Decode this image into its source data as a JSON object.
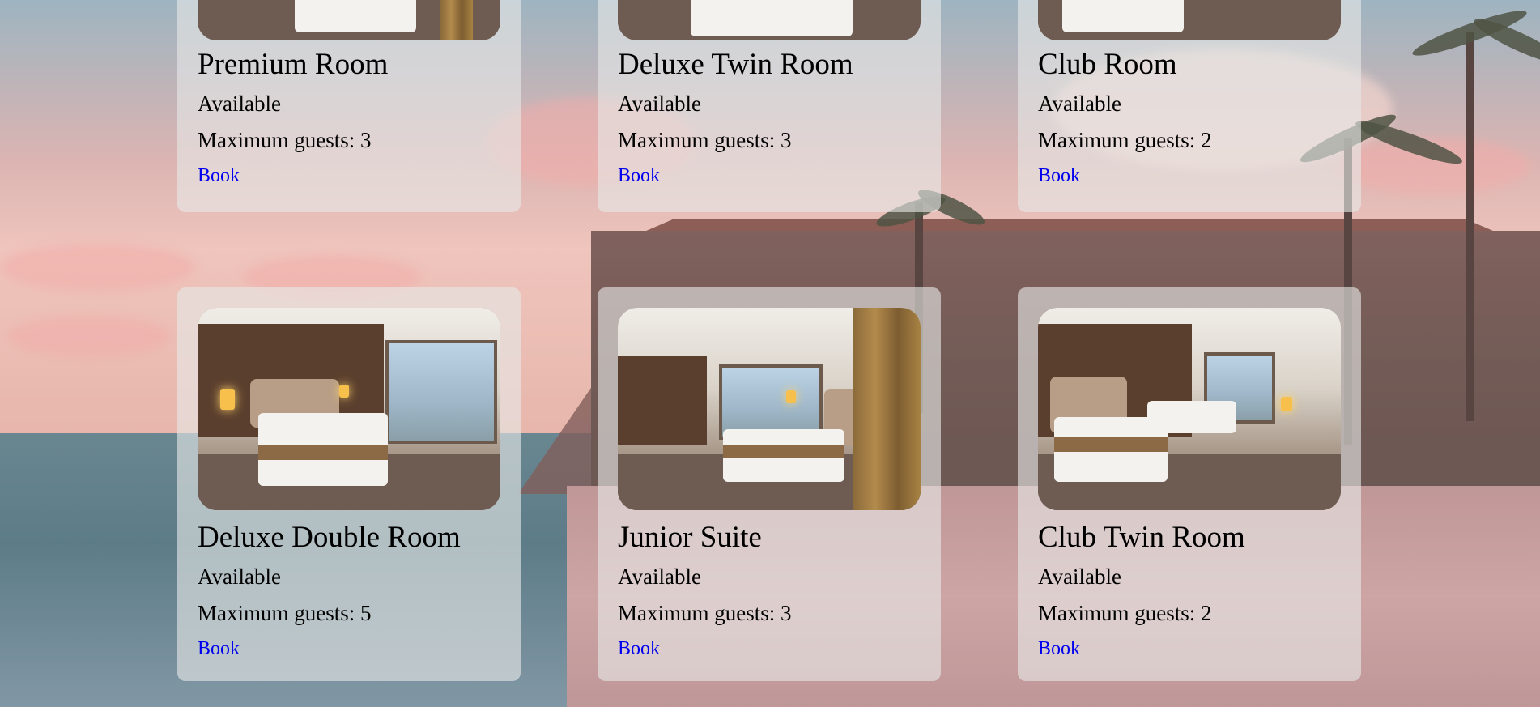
{
  "rooms": [
    {
      "name": "Premium Room",
      "status": "Available",
      "guests": "Maximum guests: 3",
      "book": "Book"
    },
    {
      "name": "Deluxe Twin Room",
      "status": "Available",
      "guests": "Maximum guests: 3",
      "book": "Book"
    },
    {
      "name": "Club Room",
      "status": "Available",
      "guests": "Maximum guests: 2",
      "book": "Book"
    },
    {
      "name": "Deluxe Double Room",
      "status": "Available",
      "guests": "Maximum guests: 5",
      "book": "Book"
    },
    {
      "name": "Junior Suite",
      "status": "Available",
      "guests": "Maximum guests: 3",
      "book": "Book"
    },
    {
      "name": "Club Twin Room",
      "status": "Available",
      "guests": "Maximum guests: 2",
      "book": "Book"
    }
  ],
  "colors": {
    "link": "#0000ee",
    "card_bg": "rgba(230,232,230,0.62)"
  }
}
